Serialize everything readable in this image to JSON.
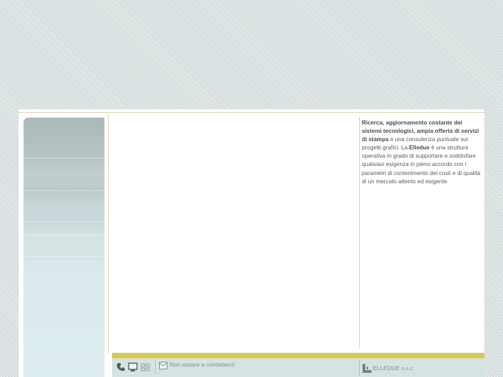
{
  "sidebar_text": {
    "bold1": "Ricerca, aggiornamento costante dei sistemi tecnologici, ampia offerta di servizi di stampa",
    "plain1": " e una consulenza puntuale sui progetti grafici. La ",
    "bold2": "Elledue",
    "plain2": " è una struttura operativa in grado di supportare e soddisfare qualsiasi esigenza in pieno accordo con i parametri di contenimento dei costi e di qualità di un mercato attento ed esigente."
  },
  "footer": {
    "contact": "Non esitare a contattarci!",
    "company": "ELLEDUE",
    "company_suffix": "s.n.c."
  },
  "colors": {
    "accent_bar": "#d6ca52",
    "footer_bg": "#d5e3e5",
    "dotted_border": "#b8a36a"
  },
  "icons": [
    "phone-icon",
    "monitor-icon",
    "grid-icon",
    "mail-icon",
    "elledue-logo-icon"
  ]
}
